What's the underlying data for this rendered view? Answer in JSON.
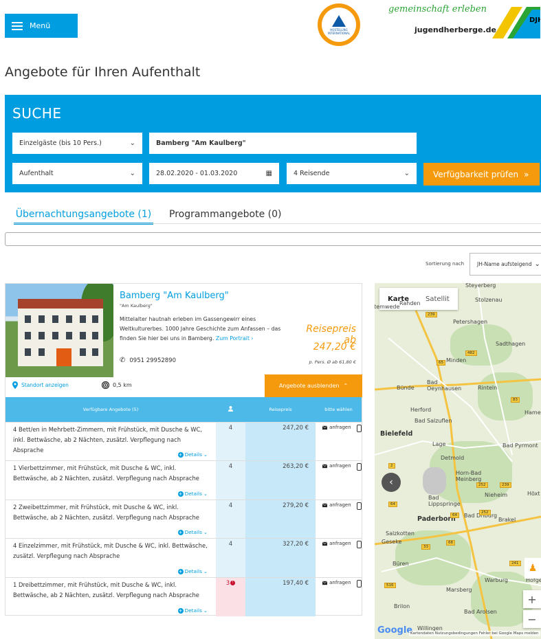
{
  "header": {
    "menu_label": "Menü",
    "hi_logo_text": "HOSTELLING INTERNATIONAL",
    "djh_script": "gemeinschaft erleben",
    "djh_domain": "jugendherberge.de",
    "djh_mark": "DJH"
  },
  "page_title": "Angebote für Ihren Aufenthalt",
  "search": {
    "title": "SUCHE",
    "guest_type": "Einzelgäste (bis 10 Pers.)",
    "hostel": "Bamberg \"Am Kaulberg\"",
    "stay_type": "Aufenthalt",
    "dates": "28.02.2020 - 01.03.2020",
    "travelers": "4 Reisende",
    "check_button": "Verfügbarkeit prüfen",
    "check_icon": "double-chevron-right"
  },
  "tabs": [
    {
      "label": "Übernachtungsangebote (1)",
      "active": true
    },
    {
      "label": "Programmangebote (0)",
      "active": false
    }
  ],
  "sort": {
    "label": "Sortierung nach",
    "value": "JH-Name aufsteigend"
  },
  "hostel": {
    "name": "Bamberg \"Am Kaulberg\"",
    "subtitle": "\"Am Kaulberg\"",
    "description": "Mittelalter hautnah erleben im Gassengewirr eines Weltkulturerbes. 1000 Jahre Geschichte zum Anfassen – das finden Sie hier bei uns in Bamberg.",
    "portrait_link": "Zum Portrait",
    "phone": "0951 29952890",
    "price_label": "Reisepreis ab",
    "price": "247,20 €",
    "price_note": "p. Pers. Ø ab 61,80 €",
    "location_link": "Standort anzeigen",
    "distance": "0,5 km",
    "hide_button": "Angebote ausblenden"
  },
  "offers_table": {
    "headers": [
      "Verfügbare Angebote (5)",
      "person-icon",
      "Reisepreis",
      "bitte wählen"
    ],
    "request_label": "anfragen",
    "details_label": "Details",
    "rows": [
      {
        "desc": "4 Bett/en in Mehrbett-Zimmern, mit Frühstück, mit Dusche & WC, inkl. Bettwäsche, ab 2 Nächten, zusätzl. Verpflegung nach Absprache",
        "count": "4",
        "price": "247,20 €"
      },
      {
        "desc": "1 Vierbettzimmer, mit Frühstück, mit Dusche & WC, inkl. Bettwäsche, ab 2 Nächten, zusätzl. Verpflegung nach Absprache",
        "count": "4",
        "price": "263,20 €"
      },
      {
        "desc": "2 Zweibettzimmer, mit Frühstück, mit Dusche & WC, inkl. Bettwäsche, ab 2 Nächten, zusätzl. Verpflegung nach Absprache",
        "count": "4",
        "price": "279,20 €"
      },
      {
        "desc": "4 Einzelzimmer, mit Frühstück, mit Dusche & WC, inkl. Bettwäsche, zusätzl. Verpflegung nach Absprache",
        "count": "4",
        "price": "327,20 €"
      },
      {
        "desc": "1 Dreibettzimmer, mit Frühstück, mit Dusche & WC, inkl. Bettwäsche, ab 2 Nächten, zusätzl. Verpflegung nach Absprache",
        "count": "3",
        "price": "197,40 €",
        "alert": true
      }
    ]
  },
  "map": {
    "tab_map": "Karte",
    "tab_satellite": "Satellit",
    "places": [
      "Steyerberg",
      "Stolzenau",
      "Rahden",
      "Stemwede",
      "Petershagen",
      "Sadthagen",
      "Minden",
      "Bad Oeynhausen",
      "Bünde",
      "Rinteln",
      "Herford",
      "Bad Salzuflen",
      "Hame",
      "Bielefeld",
      "Lage",
      "Bad Pyrmont",
      "Detmold",
      "Horn-Bad Meinberg",
      "Bad Lippspringe",
      "Nieheim",
      "Paderborn",
      "Bad Driburg",
      "Brakel",
      "Salzkotten",
      "Geseke",
      "Büren",
      "Warburg",
      "Marsberg",
      "Brilon",
      "Bad Arolsen",
      "Willingen",
      "Höxt",
      "Hofge"
    ],
    "google_label": "Google",
    "attribution": "Kartendaten   Nutzungsbedingungen   Fehler bei Google Maps melden",
    "zoom_in": "+",
    "zoom_out": "−"
  }
}
